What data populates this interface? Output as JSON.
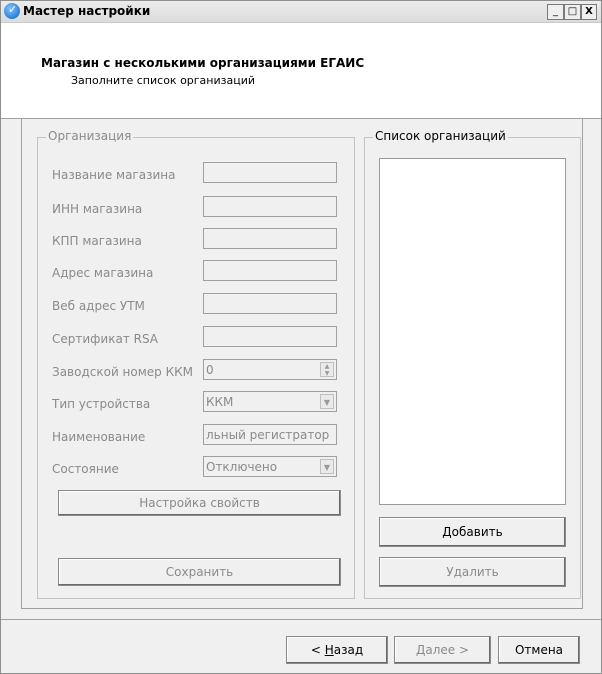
{
  "window": {
    "title": "Мастер настройки",
    "controls": {
      "minimize": "_",
      "maximize": "□",
      "close": "X"
    }
  },
  "header": {
    "title": "Магазин с несколькими организациями ЕГАИС",
    "subtitle": "Заполните список организаций"
  },
  "organization": {
    "legend": "Организация",
    "fields": {
      "store_name": {
        "label": "Название магазина",
        "value": ""
      },
      "inn": {
        "label": "ИНН магазина",
        "value": ""
      },
      "kpp": {
        "label": "КПП магазина",
        "value": ""
      },
      "address": {
        "label": "Адрес магазина",
        "value": ""
      },
      "utm_url": {
        "label": "Веб адрес УТМ",
        "value": ""
      },
      "rsa_cert": {
        "label": "Сертификат RSA",
        "value": ""
      },
      "kkm_serial": {
        "label": "Заводской номер ККМ",
        "value": "0"
      },
      "device_type": {
        "label": "Тип устройства",
        "value": "ККМ"
      },
      "device_name": {
        "label": "Наименование",
        "value": "льный регистратор"
      },
      "state": {
        "label": "Состояние",
        "value": "Отключено"
      }
    },
    "settings_button": "Настройка свойств",
    "save_button": "Сохранить"
  },
  "org_list": {
    "legend": "Список организаций",
    "items": [],
    "add_button": "Добавить",
    "delete_button": "Удалить"
  },
  "footer": {
    "back_prefix": "< ",
    "back_hotkey": "Н",
    "back_rest": "азад",
    "next_hotkey": "Д",
    "next_rest": "алее >",
    "cancel": "Отмена"
  }
}
